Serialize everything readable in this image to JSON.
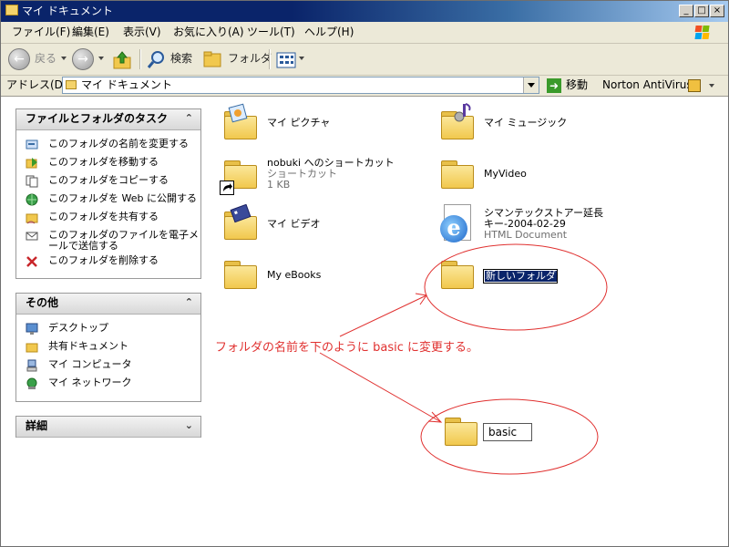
{
  "window": {
    "title": "マイ ドキュメント",
    "controls": {
      "minimize": "_",
      "maximize": "□",
      "close": "×"
    }
  },
  "menu": {
    "items": [
      "ファイル(F)",
      "編集(E)",
      "表示(V)",
      "お気に入り(A)",
      "ツール(T)",
      "ヘルプ(H)"
    ]
  },
  "toolbar": {
    "back_label": "戻る",
    "search_label": "検索",
    "folders_label": "フォルダ"
  },
  "address": {
    "label": "アドレス(D)",
    "value": "マイ ドキュメント",
    "go_label": "移動",
    "antivirus_label": "Norton AntiVirus"
  },
  "tasks_panel": {
    "title": "ファイルとフォルダのタスク",
    "items": [
      "このフォルダの名前を変更する",
      "このフォルダを移動する",
      "このフォルダをコピーする",
      "このフォルダを Web に公開する",
      "このフォルダを共有する",
      "このフォルダのファイルを電子メールで送信する",
      "このフォルダを削除する"
    ]
  },
  "other_panel": {
    "title": "その他",
    "items": [
      "デスクトップ",
      "共有ドキュメント",
      "マイ コンピュータ",
      "マイ ネットワーク"
    ]
  },
  "details_panel": {
    "title": "詳細"
  },
  "files": [
    {
      "name": "マイ ピクチャ"
    },
    {
      "name": "マイ ミュージック"
    },
    {
      "name": "nobuki へのショートカット",
      "type": "ショートカット",
      "size": "1 KB"
    },
    {
      "name": "MyVideo"
    },
    {
      "name": "マイ ビデオ"
    },
    {
      "name": "シマンテックストアー延長キー-2004-02-29",
      "type": "HTML Document"
    },
    {
      "name": "My eBooks"
    },
    {
      "name": "新しいフォルダ",
      "editing": true
    }
  ],
  "annotation": {
    "text": "フォルダの名前を下のように basic に変更する。",
    "example_name": "basic",
    "color": "#e0302f"
  }
}
